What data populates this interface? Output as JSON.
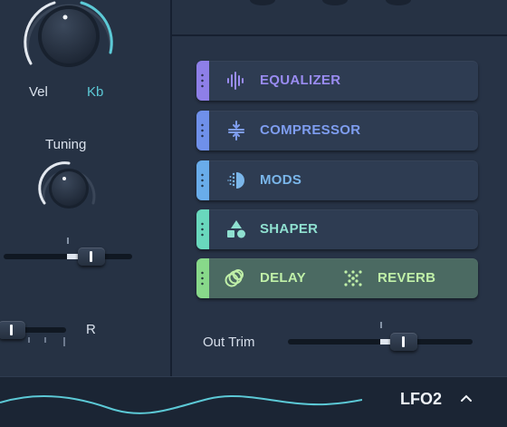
{
  "left": {
    "vel_label": "Vel",
    "kb_label": "Kb",
    "tuning_label": "Tuning",
    "r_label": "R"
  },
  "modules": [
    {
      "label": "EQUALIZER",
      "icon": "equalizer-icon",
      "color": "#9a8cf2",
      "strip": "#8e7fe8"
    },
    {
      "label": "COMPRESSOR",
      "icon": "compressor-icon",
      "color": "#7e9df0",
      "strip": "#6f90ea"
    },
    {
      "label": "MODS",
      "icon": "mods-icon",
      "color": "#7ab6ea",
      "strip": "#69acea"
    },
    {
      "label": "SHAPER",
      "icon": "shaper-icon",
      "color": "#8fe0d0",
      "strip": "#69d8bd"
    },
    {
      "label": "DELAY",
      "label2": "REVERB",
      "icon": "delay-icon",
      "icon2": "reverb-icon",
      "color": "#c0f0a8",
      "strip": "#88d98a"
    }
  ],
  "out_trim": {
    "label": "Out Trim",
    "value_fraction": 0.62
  },
  "bottom": {
    "lfo_label": "LFO2"
  }
}
